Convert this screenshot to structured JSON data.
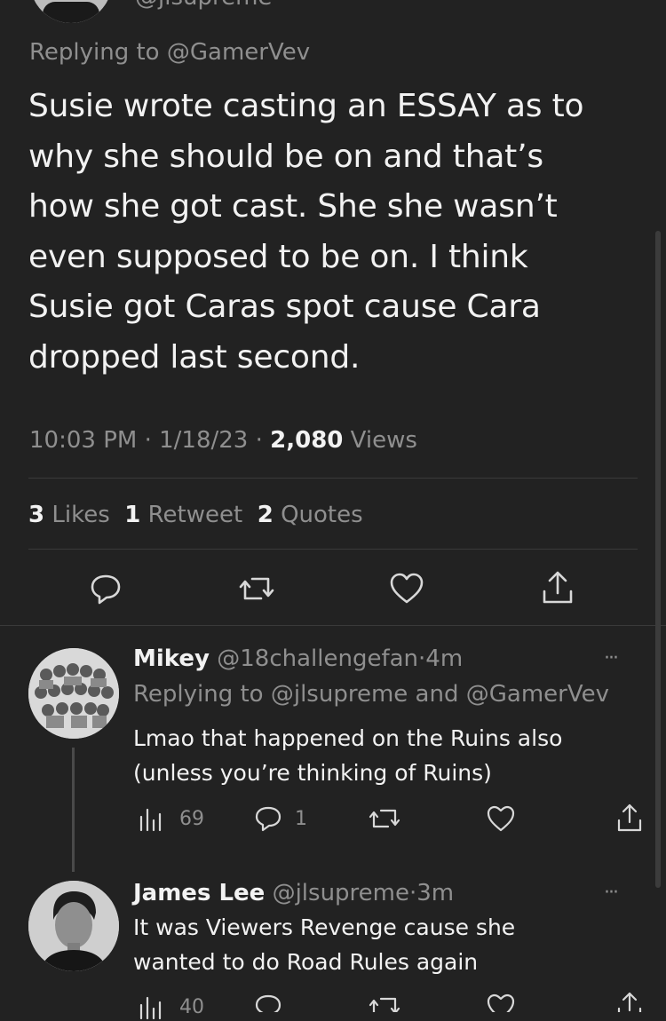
{
  "main_tweet": {
    "handle_partial": "@jlsupreme",
    "replying_prefix": "Replying to",
    "replying_to": "@GamerVev",
    "text_lines": [
      "Susie wrote casting an ESSAY as to",
      "why she should be on and that’s",
      "how she got cast. She she wasn’t",
      "even supposed to be on. I think",
      "Susie got Caras spot cause Cara",
      "dropped last second."
    ],
    "time": "10:03 PM",
    "date": "1/18/23",
    "sep": "·",
    "views_count": "2,080",
    "views_label": "Views",
    "likes_count": "3",
    "likes_label": "Likes",
    "retweets_count": "1",
    "retweets_label": "Retweet",
    "quotes_count": "2",
    "quotes_label": "Quotes",
    "actions": [
      "reply-icon",
      "retweet-icon",
      "like-icon",
      "share-icon"
    ]
  },
  "replies": [
    {
      "name": "Mikey",
      "handle": "@18challengefan",
      "sep": "·",
      "time": "4m",
      "replying_prefix": "Replying to",
      "replying_to_1": "@jlsupreme",
      "replying_and": "and",
      "replying_to_2": "@GamerVev",
      "text_lines": [
        "Lmao that happened on the Ruins also",
        "(unless you’re thinking of Ruins)"
      ],
      "views": "69",
      "replies_count": "1",
      "more": "···"
    },
    {
      "name": "James Lee",
      "handle": "@jlsupreme",
      "sep": "·",
      "time": "3m",
      "text_lines": [
        "It was Viewers Revenge cause she",
        "wanted to do Road Rules again"
      ],
      "views": "40",
      "more": "···"
    }
  ]
}
